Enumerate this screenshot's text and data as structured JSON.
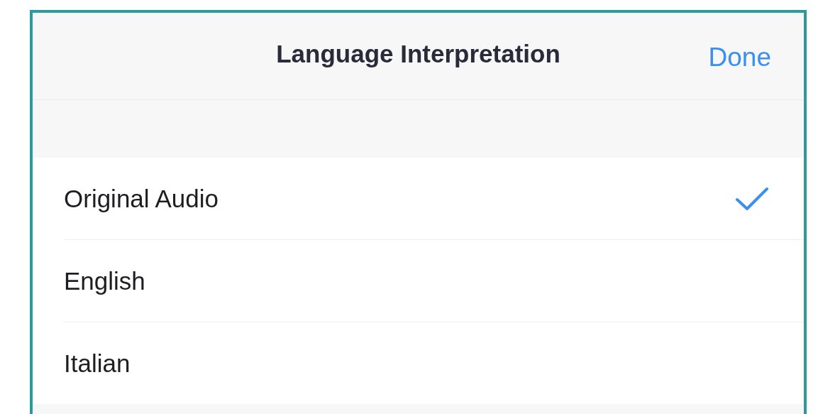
{
  "header": {
    "title": "Language Interpretation",
    "done_label": "Done"
  },
  "options": [
    {
      "label": "Original Audio",
      "selected": true
    },
    {
      "label": "English",
      "selected": false
    },
    {
      "label": "Italian",
      "selected": false
    }
  ]
}
